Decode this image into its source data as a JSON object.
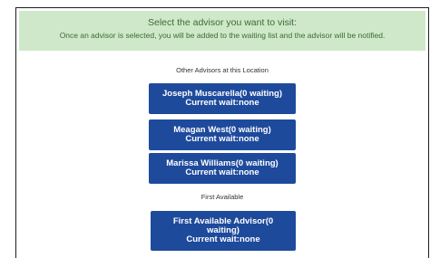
{
  "banner": {
    "title": "Select the advisor you want to visit:",
    "subtitle": "Once an advisor is selected, you will be added to the waiting list and the advisor will be notified."
  },
  "sections": {
    "other_advisors_label": "Other Advisors at this Location",
    "first_available_label": "First Available"
  },
  "advisors": [
    {
      "name_line": "Joseph Muscarella(0 waiting)",
      "wait_line": "Current wait:none"
    },
    {
      "name_line": "Meagan West(0 waiting)",
      "wait_line": "Current wait:none"
    },
    {
      "name_line": "Marissa Williams(0 waiting)",
      "wait_line": "Current wait:none"
    }
  ],
  "first_available": {
    "line1": "First Available Advisor(0",
    "line2": "waiting)",
    "line3": "Current wait:none"
  },
  "colors": {
    "banner_bg": "#cfe8c9",
    "banner_text": "#3b6b35",
    "button_bg": "#1e4a9c",
    "button_text": "#ffffff"
  }
}
